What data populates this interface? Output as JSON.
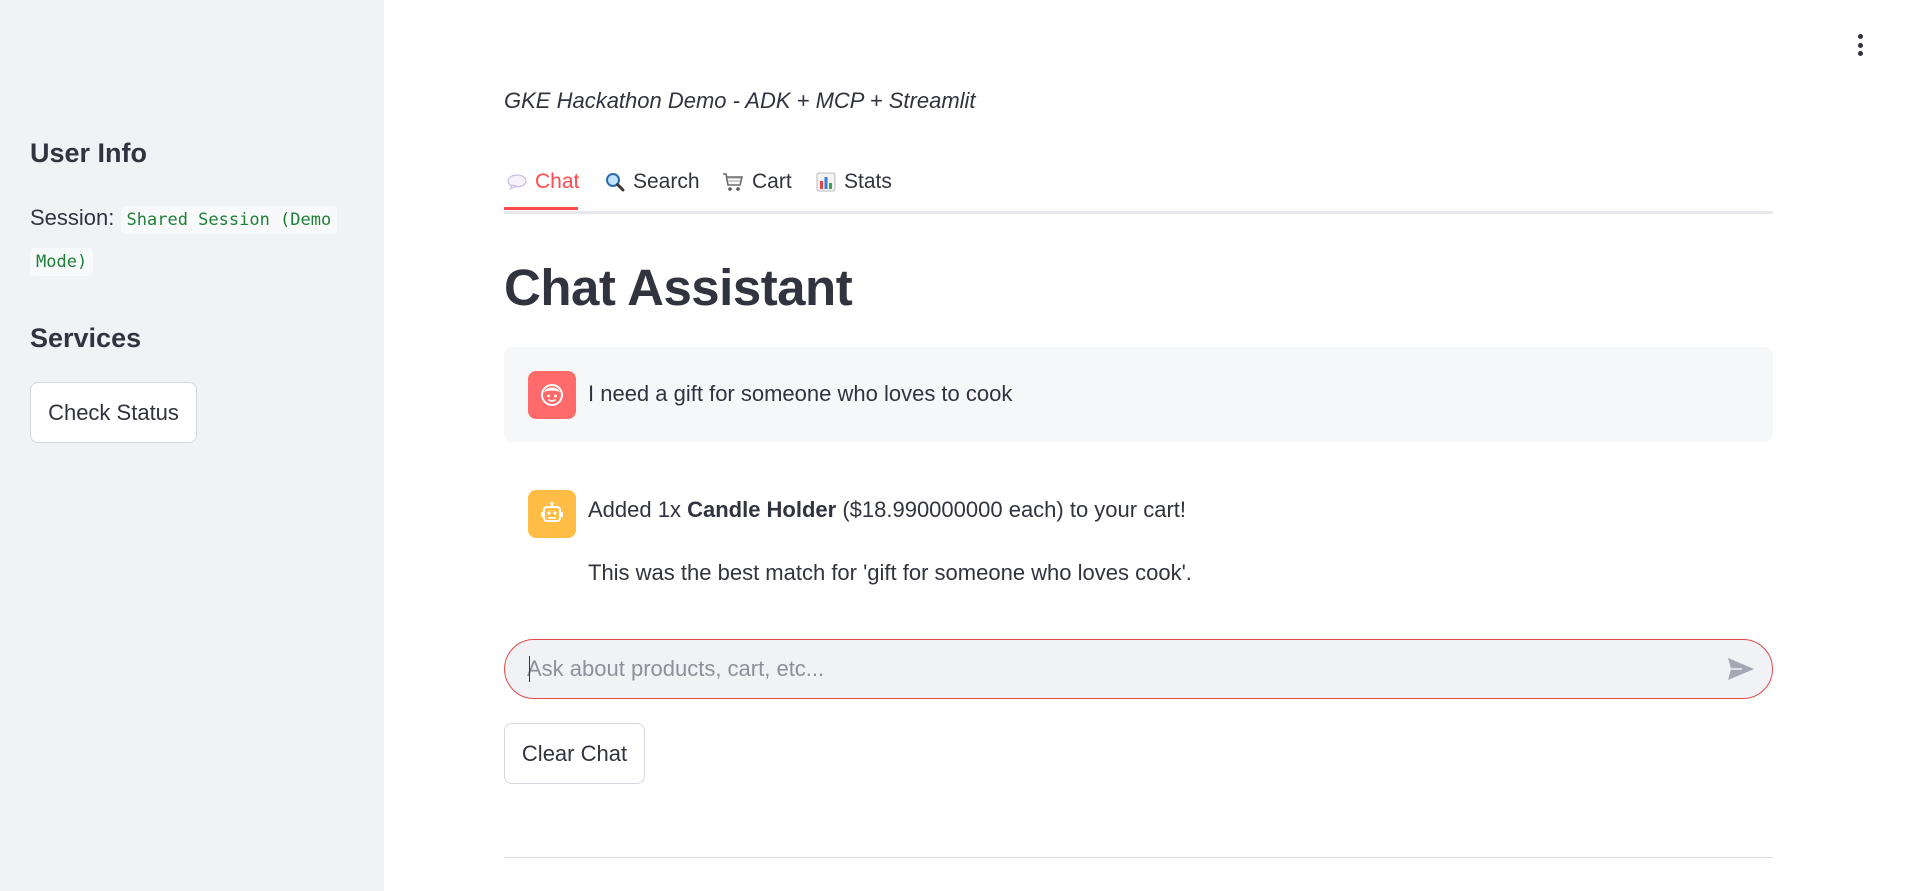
{
  "sidebar": {
    "user_info_heading": "User Info",
    "session_label": "Session:",
    "session_value": "Shared Session (Demo Mode)",
    "services_heading": "Services",
    "check_status_label": "Check Status"
  },
  "main": {
    "caption": "GKE Hackathon Demo - ADK + MCP + Streamlit",
    "tabs": [
      {
        "icon": "speech-balloon-icon",
        "label": "Chat",
        "active": true
      },
      {
        "icon": "magnifier-icon",
        "label": "Search",
        "active": false
      },
      {
        "icon": "shopping-cart-icon",
        "label": "Cart",
        "active": false
      },
      {
        "icon": "bar-chart-icon",
        "label": "Stats",
        "active": false
      }
    ],
    "page_title": "Chat Assistant",
    "messages": [
      {
        "role": "user",
        "avatar_icon": "user-face-icon",
        "text": "I need a gift for someone who loves to cook"
      },
      {
        "role": "assistant",
        "avatar_icon": "robot-icon",
        "line1_prefix": "Added 1x ",
        "line1_bold": "Candle Holder",
        "line1_suffix": " ($18.990000000 each) to your cart!",
        "line2": "This was the best match for 'gift for someone who loves cook'."
      }
    ],
    "chat_input_placeholder": "Ask about products, cart, etc...",
    "clear_chat_label": "Clear Chat"
  },
  "colors": {
    "accent": "#ff4b4b",
    "sidebar_bg": "#f0f2f6",
    "user_avatar": "#ff6b6b",
    "bot_avatar": "#ffbd45",
    "code_text": "#1f7f39"
  }
}
